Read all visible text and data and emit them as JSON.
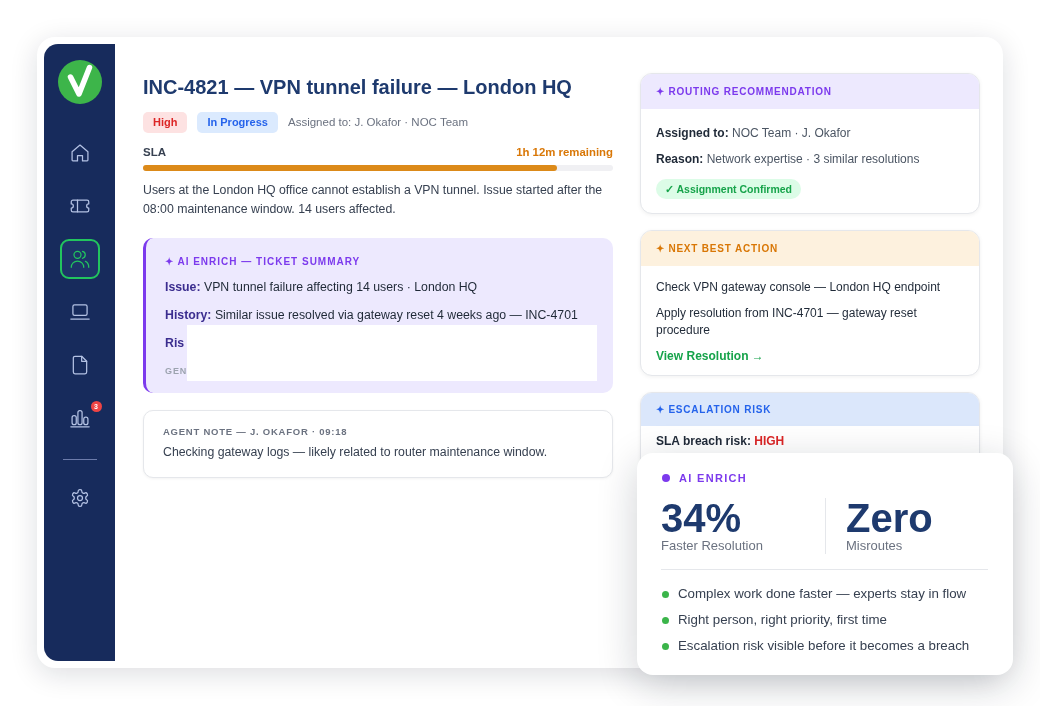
{
  "sidebar": {
    "items": [
      {
        "kind": "home",
        "selected": false
      },
      {
        "kind": "ticket",
        "selected": false
      },
      {
        "kind": "users",
        "selected": true
      },
      {
        "kind": "laptop",
        "selected": false
      },
      {
        "kind": "document",
        "selected": false
      },
      {
        "kind": "chart",
        "selected": false,
        "badge": "3"
      }
    ],
    "bottom_items": [
      {
        "kind": "settings",
        "selected": false
      }
    ]
  },
  "ticket": {
    "title": "INC-4821 — VPN tunnel failure — London HQ",
    "tags": [
      {
        "kind": "priority",
        "text": "High"
      },
      {
        "kind": "status",
        "text": "In Progress"
      }
    ],
    "assignment": "Assigned to: J. Okafor · NOC Team",
    "sla": {
      "label": "SLA",
      "remaining": "1h 12m remaining",
      "level": 0.88
    },
    "description": "Users at the London HQ office cannot establish a VPN tunnel. Issue started after the 08:00 maintenance window. 14 users affected."
  },
  "ai_summary": {
    "heading": "✦ AI ENRICH — TICKET SUMMARY",
    "lines": [
      {
        "label": "Issue:",
        "value": "VPN tunnel failure affecting 14 users · London HQ"
      },
      {
        "label": "History:",
        "value": "Similar issue resolved via gateway reset 4 weeks ago — INC-4701"
      },
      {
        "label": "Ris"
      }
    ],
    "footer": "GEN"
  },
  "agent_note": {
    "heading": "AGENT NOTE — J. OKAFOR · 09:18",
    "text": "Checking gateway logs — likely related to router maintenance window."
  },
  "cards": [
    {
      "kind": "routing",
      "heading": "✦ ROUTING RECOMMENDATION",
      "lines": [
        {
          "label": "Assigned to:",
          "value": "NOC Team · J. Okafor"
        },
        {
          "label": "Reason:",
          "value": "Network expertise · 3 similar resolutions"
        }
      ],
      "badge": "✓ Assignment Confirmed"
    },
    {
      "kind": "action",
      "heading": "✦ NEXT BEST ACTION",
      "steps": [
        "Check VPN gateway console — London HQ endpoint",
        "Apply resolution from INC-4701 — gateway reset procedure"
      ],
      "link": "View Resolution →"
    },
    {
      "kind": "escalation",
      "heading": "✦ ESCALATION RISK",
      "lines": [
        {
          "label": "SLA breach risk:",
          "value": "HIGH"
        }
      ]
    }
  ],
  "stats_panel": {
    "heading": "AI ENRICH",
    "stats": [
      {
        "value": "34%",
        "label": "Faster Resolution"
      },
      {
        "value": "Zero",
        "label": "Misroutes"
      }
    ],
    "points": [
      "Complex work done faster — experts stay in flow",
      "Right person, right priority, first time",
      "Escalation risk visible before it becomes a breach"
    ]
  }
}
